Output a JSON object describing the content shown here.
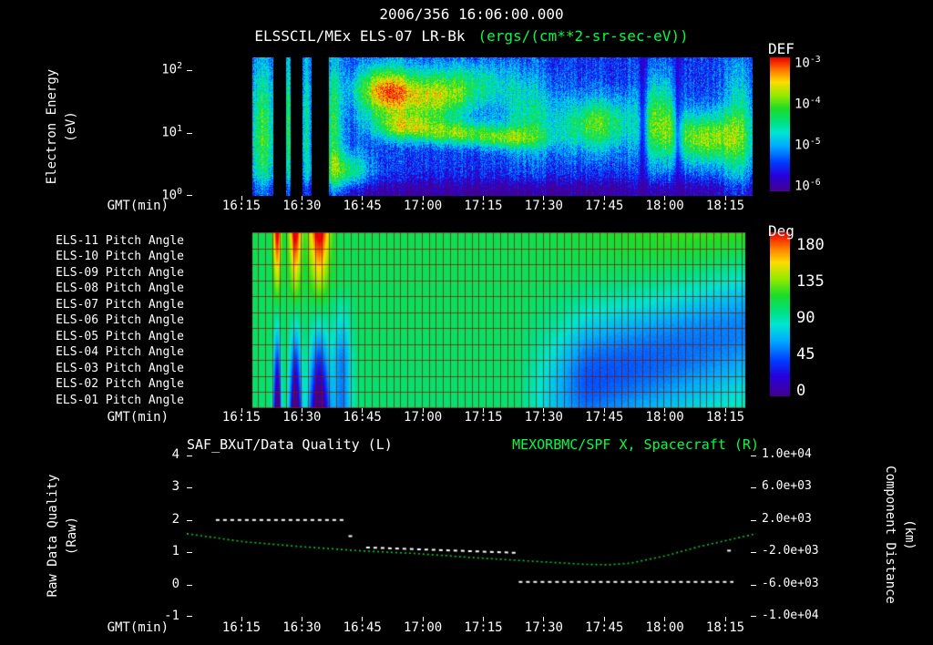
{
  "colors": {
    "background": "#000000",
    "text": "#ffffff",
    "green_text": "#00ff41",
    "curve_green": "#00cc33",
    "grid_red": "#801400"
  },
  "header": {
    "datetime": "2006/356 16:06:00.000",
    "instrument": "ELSSCIL/MEx ELS-07 LR-Bk",
    "units": "(ergs/(cm**2-sr-sec-eV))"
  },
  "time_axis": {
    "label": "GMT(min)",
    "ticks": [
      {
        "label": "16:15",
        "f": 0.096
      },
      {
        "label": "16:30",
        "f": 0.2022
      },
      {
        "label": "16:45",
        "f": 0.3084
      },
      {
        "label": "17:00",
        "f": 0.4146
      },
      {
        "label": "17:15",
        "f": 0.5208
      },
      {
        "label": "17:30",
        "f": 0.627
      },
      {
        "label": "17:45",
        "f": 0.7332
      },
      {
        "label": "18:00",
        "f": 0.8394
      },
      {
        "label": "18:15",
        "f": 0.9456
      }
    ]
  },
  "energy_panel": {
    "ylabel_line1": "Electron Energy",
    "ylabel_line2": "(eV)",
    "yticks": [
      {
        "base": "10",
        "exp": "2",
        "decade": 2
      },
      {
        "base": "10",
        "exp": "1",
        "decade": 1
      },
      {
        "base": "10",
        "exp": "0",
        "decade": 0
      }
    ],
    "colorbar": {
      "label": "DEF",
      "ticks": [
        {
          "base": "10",
          "exp": "-3",
          "f": 0.048
        },
        {
          "base": "10",
          "exp": "-4",
          "f": 0.354
        },
        {
          "base": "10",
          "exp": "-5",
          "f": 0.66
        },
        {
          "base": "10",
          "exp": "-6",
          "f": 0.966
        }
      ]
    }
  },
  "pitch_panel": {
    "row_labels": [
      "ELS-11 Pitch Angle",
      "ELS-10 Pitch Angle",
      "ELS-09 Pitch Angle",
      "ELS-08 Pitch Angle",
      "ELS-07 Pitch Angle",
      "ELS-06 Pitch Angle",
      "ELS-05 Pitch Angle",
      "ELS-04 Pitch Angle",
      "ELS-03 Pitch Angle",
      "ELS-02 Pitch Angle",
      "ELS-01 Pitch Angle"
    ],
    "colorbar": {
      "label": "Deg",
      "ticks": [
        {
          "label": "180",
          "f": 0.083
        },
        {
          "label": "135",
          "f": 0.306
        },
        {
          "label": "90",
          "f": 0.528
        },
        {
          "label": "45",
          "f": 0.75
        },
        {
          "label": "0",
          "f": 0.972
        }
      ]
    }
  },
  "quality_panel": {
    "title_left": "SAF_BXuT/Data Quality (L)",
    "title_right": "MEXORBMC/SPF X, Spacecraft (R)",
    "ylabel_left_line1": "Raw Data Quality",
    "ylabel_left_line2": "(Raw)",
    "ylabel_right_line1": "Component Distance",
    "ylabel_right_line2": "(km)",
    "yticks_left": [
      {
        "label": "4",
        "v": 4
      },
      {
        "label": "3",
        "v": 3
      },
      {
        "label": "2",
        "v": 2
      },
      {
        "label": "1",
        "v": 1
      },
      {
        "label": "0",
        "v": 0
      },
      {
        "label": "-1",
        "v": -1
      }
    ],
    "yticks_right": [
      {
        "label": "1.0e+04",
        "v": 10000
      },
      {
        "label": "6.0e+03",
        "v": 6000
      },
      {
        "label": "2.0e+03",
        "v": 2000
      },
      {
        "label": "-2.0e+03",
        "v": -2000
      },
      {
        "label": "-6.0e+03",
        "v": -6000
      },
      {
        "label": "-1.0e+04",
        "v": -10000
      }
    ]
  },
  "chart_data": [
    {
      "type": "heatmap",
      "name": "electron-energy-spectrogram",
      "title": "ELSSCIL/MEx ELS-07 LR-Bk",
      "units": "ergs/(cm**2-sr-sec-eV)",
      "xlabel": "GMT(min)",
      "ylabel": "Electron Energy (eV)",
      "y_scale": "log",
      "ylim_eV": [
        1,
        158
      ],
      "x_ticks": [
        "16:15",
        "16:30",
        "16:45",
        "17:00",
        "17:15",
        "17:30",
        "17:45",
        "18:00",
        "18:15"
      ],
      "colorbar_scale": "log",
      "colorbar_tick_values": [
        0.001,
        0.0001,
        1e-05,
        1e-06
      ],
      "data_window": [
        0.115,
        0.993
      ],
      "gaps": [
        [
          0.152,
          0.173
        ],
        [
          0.181,
          0.203
        ],
        [
          0.218,
          0.248
        ]
      ],
      "dark_lanes": [
        [
          0.8,
          0.005,
          0.6
        ],
        [
          0.862,
          0.005,
          0.55
        ]
      ],
      "base_level": 0.2,
      "pixel_noise": 0.12,
      "column_noise": 0.06,
      "features": [
        [
          0.133,
          0.45,
          0.016,
          0.4,
          0.42
        ],
        [
          0.176,
          0.5,
          0.007,
          0.45,
          0.35
        ],
        [
          0.21,
          0.5,
          0.006,
          0.45,
          0.3
        ],
        [
          0.258,
          0.5,
          0.01,
          0.4,
          0.38
        ],
        [
          0.28,
          0.18,
          0.03,
          0.1,
          0.35
        ],
        [
          0.345,
          0.76,
          0.035,
          0.13,
          0.62
        ],
        [
          0.43,
          0.7,
          0.05,
          0.12,
          0.45
        ],
        [
          0.38,
          0.5,
          0.04,
          0.07,
          0.4
        ],
        [
          0.47,
          0.46,
          0.05,
          0.06,
          0.38
        ],
        [
          0.56,
          0.42,
          0.05,
          0.055,
          0.33
        ],
        [
          0.5,
          0.82,
          0.07,
          0.12,
          0.25
        ],
        [
          0.6,
          0.55,
          0.035,
          0.18,
          0.28
        ],
        [
          0.72,
          0.52,
          0.045,
          0.14,
          0.45
        ],
        [
          0.83,
          0.55,
          0.025,
          0.22,
          0.4
        ],
        [
          0.91,
          0.42,
          0.045,
          0.13,
          0.5
        ],
        [
          0.97,
          0.5,
          0.02,
          0.35,
          0.32
        ],
        [
          0.5,
          0.03,
          0.6,
          0.07,
          -0.18
        ]
      ]
    },
    {
      "type": "heatmap",
      "name": "pitch-angle-panel",
      "rows": [
        "ELS-11",
        "ELS-10",
        "ELS-09",
        "ELS-08",
        "ELS-07",
        "ELS-06",
        "ELS-05",
        "ELS-04",
        "ELS-03",
        "ELS-02",
        "ELS-01"
      ],
      "value_units": "deg",
      "value_range": [
        0,
        180
      ],
      "data_window": [
        0.115,
        0.98
      ],
      "base_deg": 103,
      "row_gradient_deg": -6,
      "stripes": [
        [
          0.158,
          0.0045
        ],
        [
          0.19,
          0.007
        ],
        [
          0.232,
          0.012
        ]
      ],
      "blue_stripe": [
        0.272,
        0.012,
        45
      ],
      "tilt_start": 0.55,
      "tilt_top_deg": 20,
      "band": {
        "depth_deg": 55,
        "u_width": 0.28,
        "u_center_at_t0": 1.6,
        "u_slope": -1.1,
        "fade_in": [
          0.58,
          0.7
        ]
      },
      "grid_cols": 80,
      "pixel_noise_deg": 3
    },
    {
      "type": "line",
      "name": "quality-and-distance",
      "title_left": "SAF_BXuT/Data Quality (L)",
      "title_right": "MEXORBMC/SPF X, Spacecraft (R)",
      "left_axis": {
        "label": "Raw Data Quality (Raw)",
        "range": [
          -1,
          4
        ]
      },
      "right_axis": {
        "label": "Component Distance (km)",
        "range": [
          -10000,
          10000
        ]
      },
      "series": [
        {
          "name": "SAF_BXuT/Data Quality",
          "axis": "left",
          "style": "dashed",
          "color": "#ffffff",
          "segments": [
            {
              "t": [
                0.051,
                0.28
              ],
              "v": [
                2.0,
                2.0
              ]
            },
            {
              "t": [
                0.284,
                0.292
              ],
              "v": [
                1.5,
                1.5
              ]
            },
            {
              "t": [
                0.315,
                0.583
              ],
              "v": [
                1.15,
                0.98
              ]
            },
            {
              "t": [
                0.583,
                0.96
              ],
              "v": [
                0.08,
                0.08
              ]
            },
            {
              "t": [
                0.949,
                0.962
              ],
              "v": [
                1.05,
                1.05
              ]
            }
          ]
        },
        {
          "name": "MEXORBMC/SPF X Spacecraft",
          "axis": "right",
          "style": "dotted",
          "color": "#00cc33",
          "t": [
            0.0,
            0.1,
            0.2,
            0.3,
            0.4,
            0.5,
            0.58,
            0.64,
            0.7,
            0.74,
            0.78,
            0.84,
            0.9,
            0.95,
            1.0
          ],
          "km": [
            300,
            -700,
            -1300,
            -1800,
            -2150,
            -2650,
            -3000,
            -3250,
            -3500,
            -3550,
            -3350,
            -2450,
            -1300,
            -500,
            300
          ]
        }
      ]
    }
  ]
}
